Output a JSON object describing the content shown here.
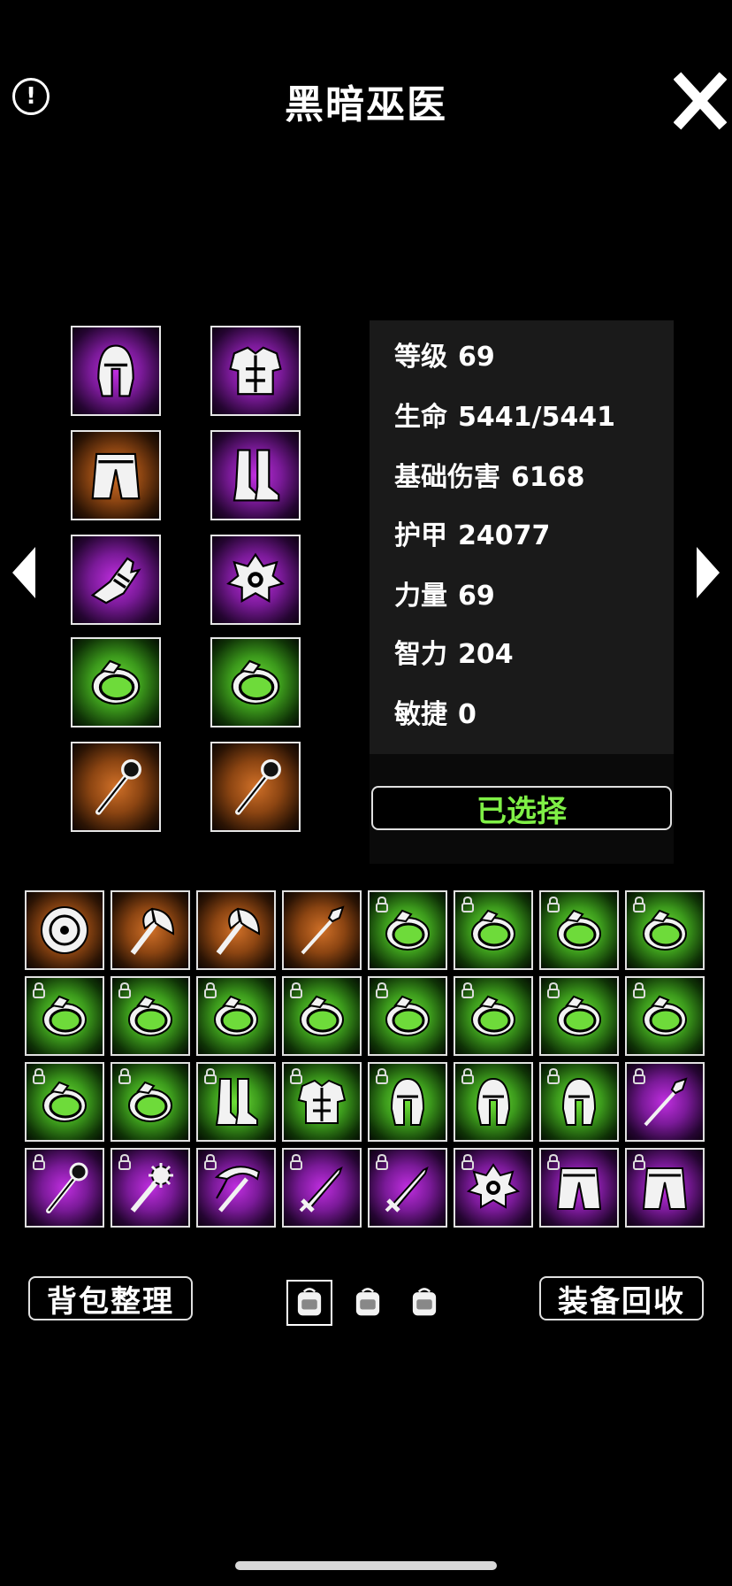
{
  "header": {
    "title": "黑暗巫医",
    "info_label": "!"
  },
  "stats": [
    {
      "label": "等级",
      "value": "69"
    },
    {
      "label": "生命",
      "value": "5441/5441"
    },
    {
      "label": "基础伤害",
      "value": "6168"
    },
    {
      "label": "护甲",
      "value": "24077"
    },
    {
      "label": "力量",
      "value": "69"
    },
    {
      "label": "智力",
      "value": "204"
    },
    {
      "label": "敏捷",
      "value": "0"
    }
  ],
  "selected_button": "已选择",
  "equipment": [
    {
      "slot": "helmet",
      "rarity": "purple",
      "icon": "helmet-icon"
    },
    {
      "slot": "armor",
      "rarity": "purple",
      "icon": "chest-armor-icon"
    },
    {
      "slot": "pants",
      "rarity": "orange",
      "icon": "pants-icon"
    },
    {
      "slot": "boots",
      "rarity": "purple",
      "icon": "boots-icon"
    },
    {
      "slot": "gloves",
      "rarity": "purple",
      "icon": "gauntlet-icon"
    },
    {
      "slot": "amulet",
      "rarity": "purple",
      "icon": "amulet-icon"
    },
    {
      "slot": "ring-1",
      "rarity": "green",
      "icon": "ring-icon"
    },
    {
      "slot": "ring-2",
      "rarity": "green",
      "icon": "ring-icon"
    },
    {
      "slot": "weapon-1",
      "rarity": "orange",
      "icon": "staff-icon"
    },
    {
      "slot": "weapon-2",
      "rarity": "orange",
      "icon": "staff-icon"
    }
  ],
  "inventory": [
    {
      "rarity": "orange",
      "icon": "shield-icon",
      "locked": false
    },
    {
      "rarity": "orange",
      "icon": "axe-icon",
      "locked": false
    },
    {
      "rarity": "orange",
      "icon": "axe-icon",
      "locked": false
    },
    {
      "rarity": "orange",
      "icon": "spear-icon",
      "locked": false
    },
    {
      "rarity": "green",
      "icon": "ring-icon",
      "locked": true
    },
    {
      "rarity": "green",
      "icon": "ring-icon",
      "locked": true
    },
    {
      "rarity": "green",
      "icon": "ring-icon",
      "locked": true
    },
    {
      "rarity": "green",
      "icon": "ring-icon",
      "locked": true
    },
    {
      "rarity": "green",
      "icon": "ring-icon",
      "locked": true
    },
    {
      "rarity": "green",
      "icon": "ring-icon",
      "locked": true
    },
    {
      "rarity": "green",
      "icon": "ring-icon",
      "locked": true
    },
    {
      "rarity": "green",
      "icon": "ring-icon",
      "locked": true
    },
    {
      "rarity": "green",
      "icon": "ring-icon",
      "locked": true
    },
    {
      "rarity": "green",
      "icon": "ring-icon",
      "locked": true
    },
    {
      "rarity": "green",
      "icon": "ring-icon",
      "locked": true
    },
    {
      "rarity": "green",
      "icon": "ring-icon",
      "locked": true
    },
    {
      "rarity": "green",
      "icon": "ring-icon",
      "locked": true
    },
    {
      "rarity": "green",
      "icon": "ring-icon",
      "locked": true
    },
    {
      "rarity": "green",
      "icon": "boots-icon",
      "locked": true
    },
    {
      "rarity": "green",
      "icon": "chest-armor-icon",
      "locked": true
    },
    {
      "rarity": "green",
      "icon": "helmet-icon",
      "locked": true
    },
    {
      "rarity": "green",
      "icon": "helmet-icon",
      "locked": true
    },
    {
      "rarity": "green",
      "icon": "helmet-icon",
      "locked": true
    },
    {
      "rarity": "purple",
      "icon": "spear-icon",
      "locked": true
    },
    {
      "rarity": "purple",
      "icon": "staff-icon",
      "locked": true
    },
    {
      "rarity": "purple",
      "icon": "mace-icon",
      "locked": true
    },
    {
      "rarity": "purple",
      "icon": "pickaxe-icon",
      "locked": true
    },
    {
      "rarity": "purple",
      "icon": "sword-icon",
      "locked": true
    },
    {
      "rarity": "purple",
      "icon": "sword-icon",
      "locked": true
    },
    {
      "rarity": "purple",
      "icon": "amulet-icon",
      "locked": true
    },
    {
      "rarity": "purple",
      "icon": "pants-icon",
      "locked": true
    },
    {
      "rarity": "purple",
      "icon": "pants-icon",
      "locked": true
    }
  ],
  "bottom": {
    "sort_label": "背包整理",
    "recycle_label": "装备回收",
    "bag_tabs": [
      {
        "icon": "backpack-icon",
        "active": true
      },
      {
        "icon": "backpack-icon",
        "active": false
      },
      {
        "icon": "backpack-icon",
        "active": false
      }
    ]
  }
}
